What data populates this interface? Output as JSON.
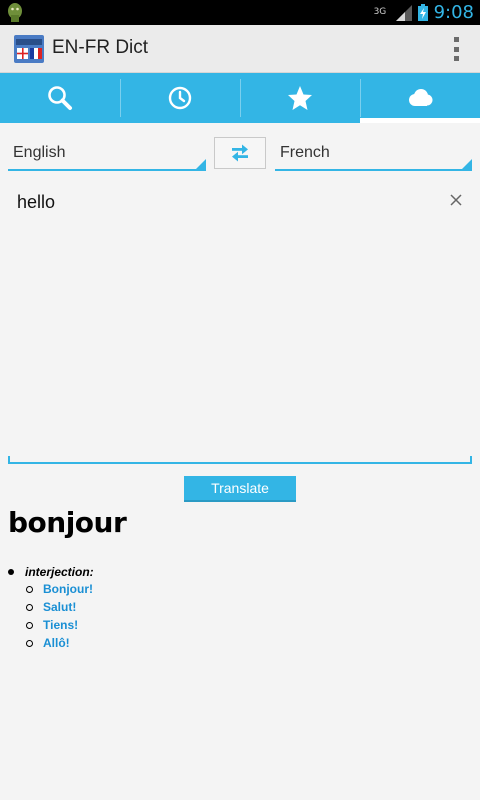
{
  "status_bar": {
    "network": "3G",
    "time": "9:08"
  },
  "action_bar": {
    "title": "EN-FR Dict",
    "icon": "en-fr-flags-icon"
  },
  "tabs": [
    {
      "icon": "search-icon",
      "selected": false
    },
    {
      "icon": "clock-icon",
      "selected": false
    },
    {
      "icon": "star-icon",
      "selected": false
    },
    {
      "icon": "cloud-icon",
      "selected": true
    }
  ],
  "languages": {
    "source": "English",
    "target": "French"
  },
  "input": {
    "value": "hello"
  },
  "translate_button": {
    "label": "Translate"
  },
  "result": {
    "word": "bonjour",
    "part_of_speech": "interjection:",
    "translations": [
      "Bonjour!",
      "Salut!",
      "Tiens!",
      "Allô!"
    ]
  },
  "colors": {
    "accent": "#33b5e5",
    "link": "#1a8fd4"
  }
}
